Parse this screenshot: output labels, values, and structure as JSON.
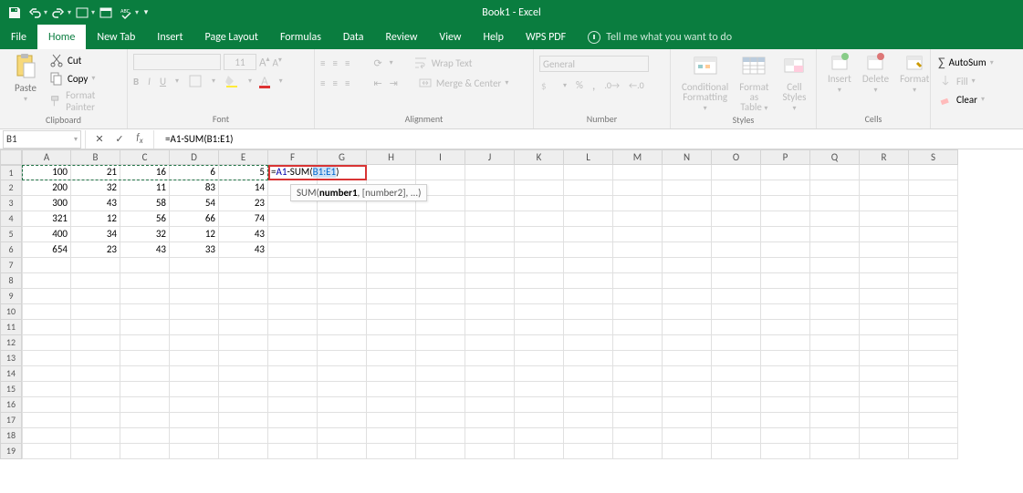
{
  "title": "Book1 - Excel",
  "tabs": {
    "file": "File",
    "home": "Home",
    "newtab": "New Tab",
    "insert": "Insert",
    "pageLayout": "Page Layout",
    "formulas": "Formulas",
    "data": "Data",
    "review": "Review",
    "view": "View",
    "help": "Help",
    "wpspdf": "WPS PDF",
    "tellme": "Tell me what you want to do"
  },
  "ribbon": {
    "clipboard": {
      "label": "Clipboard",
      "paste": "Paste",
      "cut": "Cut",
      "copy": "Copy",
      "fp": "Format Painter"
    },
    "font": {
      "label": "Font",
      "name": "",
      "size": "11"
    },
    "alignment": {
      "label": "Alignment",
      "wrap": "Wrap Text",
      "merge": "Merge & Center"
    },
    "number": {
      "label": "Number",
      "format": "General"
    },
    "styles": {
      "label": "Styles",
      "cf": "Conditional\nFormatting",
      "fat": "Format as\nTable",
      "cs": "Cell\nStyles"
    },
    "cells": {
      "label": "Cells",
      "insert": "Insert",
      "delete": "Delete",
      "format": "Format"
    },
    "editing": {
      "label": "",
      "autosum": "AutoSum",
      "fill": "Fill",
      "clear": "Clear"
    }
  },
  "formulaBar": {
    "nameBox": "B1",
    "formula_prefix": "=",
    "formula_a1": "A1",
    "formula_mid": "-SUM(",
    "formula_range": "B1:E1",
    "formula_end": ")"
  },
  "tooltip": {
    "fn": "SUM(",
    "b": "number1",
    "rest": ", [number2], ...)"
  },
  "columns": [
    "A",
    "B",
    "C",
    "D",
    "E",
    "F",
    "G",
    "H",
    "I",
    "J",
    "K",
    "L",
    "M",
    "N",
    "O",
    "P",
    "Q",
    "R",
    "S"
  ],
  "rows": [
    1,
    2,
    3,
    4,
    5,
    6,
    7,
    8,
    9,
    10,
    11,
    12,
    13,
    14,
    15,
    16,
    17,
    18,
    19
  ],
  "data": [
    [
      "100",
      "21",
      "16",
      "6",
      "5",
      "=A1-SUM(B1:E1)",
      "",
      "",
      "",
      "",
      "",
      "",
      "",
      "",
      "",
      "",
      "",
      "",
      ""
    ],
    [
      "200",
      "32",
      "11",
      "83",
      "14",
      "",
      "",
      "",
      "",
      "",
      "",
      "",
      "",
      "",
      "",
      "",
      "",
      "",
      ""
    ],
    [
      "300",
      "43",
      "58",
      "54",
      "23",
      "",
      "",
      "",
      "",
      "",
      "",
      "",
      "",
      "",
      "",
      "",
      "",
      "",
      ""
    ],
    [
      "321",
      "12",
      "56",
      "66",
      "74",
      "",
      "",
      "",
      "",
      "",
      "",
      "",
      "",
      "",
      "",
      "",
      "",
      "",
      ""
    ],
    [
      "400",
      "34",
      "32",
      "12",
      "43",
      "",
      "",
      "",
      "",
      "",
      "",
      "",
      "",
      "",
      "",
      "",
      "",
      "",
      ""
    ],
    [
      "654",
      "23",
      "43",
      "33",
      "43",
      "",
      "",
      "",
      "",
      "",
      "",
      "",
      "",
      "",
      "",
      "",
      "",
      "",
      ""
    ],
    [
      "",
      "",
      "",
      "",
      "",
      "",
      "",
      "",
      "",
      "",
      "",
      "",
      "",
      "",
      "",
      "",
      "",
      "",
      ""
    ],
    [
      "",
      "",
      "",
      "",
      "",
      "",
      "",
      "",
      "",
      "",
      "",
      "",
      "",
      "",
      "",
      "",
      "",
      "",
      ""
    ],
    [
      "",
      "",
      "",
      "",
      "",
      "",
      "",
      "",
      "",
      "",
      "",
      "",
      "",
      "",
      "",
      "",
      "",
      "",
      ""
    ],
    [
      "",
      "",
      "",
      "",
      "",
      "",
      "",
      "",
      "",
      "",
      "",
      "",
      "",
      "",
      "",
      "",
      "",
      "",
      ""
    ],
    [
      "",
      "",
      "",
      "",
      "",
      "",
      "",
      "",
      "",
      "",
      "",
      "",
      "",
      "",
      "",
      "",
      "",
      "",
      ""
    ],
    [
      "",
      "",
      "",
      "",
      "",
      "",
      "",
      "",
      "",
      "",
      "",
      "",
      "",
      "",
      "",
      "",
      "",
      "",
      ""
    ],
    [
      "",
      "",
      "",
      "",
      "",
      "",
      "",
      "",
      "",
      "",
      "",
      "",
      "",
      "",
      "",
      "",
      "",
      "",
      ""
    ],
    [
      "",
      "",
      "",
      "",
      "",
      "",
      "",
      "",
      "",
      "",
      "",
      "",
      "",
      "",
      "",
      "",
      "",
      "",
      ""
    ],
    [
      "",
      "",
      "",
      "",
      "",
      "",
      "",
      "",
      "",
      "",
      "",
      "",
      "",
      "",
      "",
      "",
      "",
      "",
      ""
    ],
    [
      "",
      "",
      "",
      "",
      "",
      "",
      "",
      "",
      "",
      "",
      "",
      "",
      "",
      "",
      "",
      "",
      "",
      "",
      ""
    ],
    [
      "",
      "",
      "",
      "",
      "",
      "",
      "",
      "",
      "",
      "",
      "",
      "",
      "",
      "",
      "",
      "",
      "",
      "",
      ""
    ],
    [
      "",
      "",
      "",
      "",
      "",
      "",
      "",
      "",
      "",
      "",
      "",
      "",
      "",
      "",
      "",
      "",
      "",
      "",
      ""
    ],
    [
      "",
      "",
      "",
      "",
      "",
      "",
      "",
      "",
      "",
      "",
      "",
      "",
      "",
      "",
      "",
      "",
      "",
      "",
      ""
    ]
  ]
}
